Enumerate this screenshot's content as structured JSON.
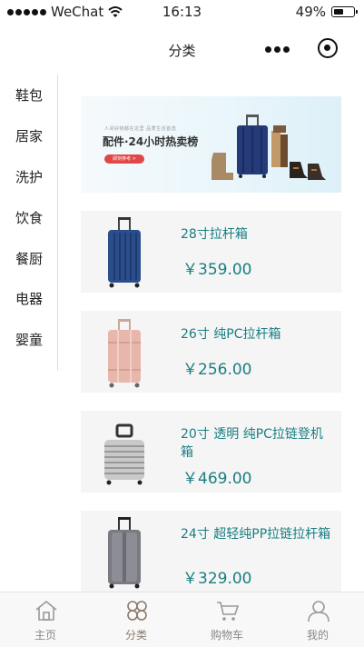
{
  "status_bar": {
    "carrier": "WeChat",
    "time": "16:13",
    "battery_text": "49%",
    "battery_level": 0.49
  },
  "nav": {
    "title": "分类"
  },
  "sidebar": {
    "items": [
      {
        "label": "鞋包",
        "active": true
      },
      {
        "label": "居家",
        "active": false
      },
      {
        "label": "洗护",
        "active": false
      },
      {
        "label": "饮食",
        "active": false
      },
      {
        "label": "餐厨",
        "active": false
      },
      {
        "label": "电器",
        "active": false
      },
      {
        "label": "婴童",
        "active": false
      }
    ]
  },
  "banner": {
    "small_text": "人间好物都在这里   品质生活首选",
    "title": "配件·24小时热卖榜",
    "button_label": "即刻参考 >"
  },
  "products": [
    {
      "name": "28寸拉杆箱",
      "price": "￥359.00",
      "color": "#2b4d8c"
    },
    {
      "name": "26寸 纯PC拉杆箱",
      "price": "￥256.00",
      "color": "#e7b7ab"
    },
    {
      "name": "20寸 透明 纯PC拉链登机箱",
      "price": "￥469.00",
      "color": "#c9c9c9"
    },
    {
      "name": "24寸 超轻纯PP拉链拉杆箱",
      "price": "￥329.00",
      "color": "#7a7a82"
    }
  ],
  "tab_bar": {
    "tabs": [
      {
        "label": "主页",
        "icon": "home-icon",
        "active": false
      },
      {
        "label": "分类",
        "icon": "category-icon",
        "active": true
      },
      {
        "label": "购物车",
        "icon": "cart-icon",
        "active": false
      },
      {
        "label": "我的",
        "icon": "profile-icon",
        "active": false
      }
    ]
  },
  "colors": {
    "accent_red": "#e02020",
    "price_teal": "#1a7e82",
    "card_bg": "#f5f5f5"
  }
}
